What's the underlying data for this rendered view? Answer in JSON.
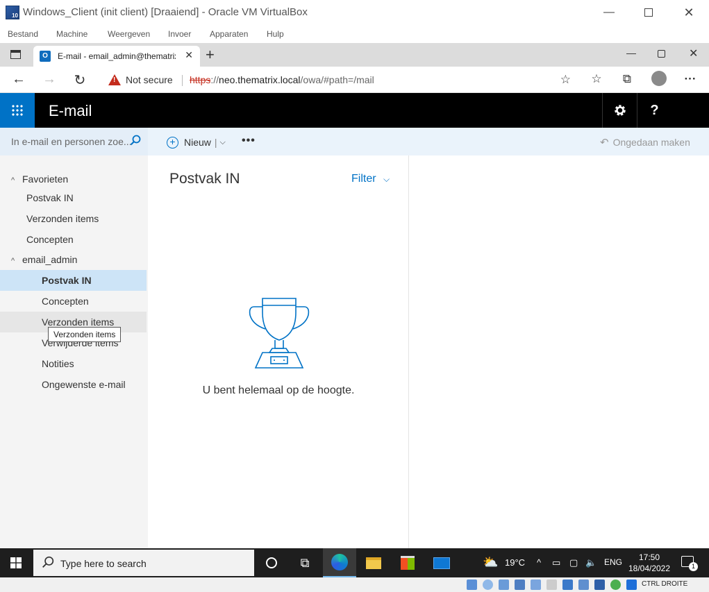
{
  "vbox": {
    "title": "Windows_Client (init client) [Draaiend] - Oracle VM VirtualBox",
    "menu": [
      "Bestand",
      "Machine",
      "Weergeven",
      "Invoer",
      "Apparaten",
      "Hulp"
    ],
    "host_key": "CTRL DROITE"
  },
  "browser": {
    "tab_title": "E-mail - email_admin@thematrix.local",
    "security_label": "Not secure",
    "url": {
      "scheme": "https",
      "sep": "://",
      "host": "neo.thematrix.local",
      "path": "/owa/#path=/mail"
    }
  },
  "owa": {
    "app_title": "E-mail",
    "settings_icon": "gear-icon",
    "help_label": "?",
    "search_placeholder": "In e-mail en personen zoe...",
    "new_label": "Nieuw",
    "undo_label": "Ongedaan maken",
    "favorites_label": "Favorieten",
    "favorites": [
      "Postvak IN",
      "Verzonden items",
      "Concepten"
    ],
    "account_label": "email_admin",
    "account_folders": [
      "Postvak IN",
      "Concepten",
      "Verzonden items",
      "Verwijderde items",
      "Notities",
      "Ongewenste e-mail"
    ],
    "tooltip": "Verzonden items",
    "list_title": "Postvak IN",
    "filter_label": "Filter",
    "empty_message": "U bent helemaal op de hoogte."
  },
  "taskbar": {
    "search_placeholder": "Type here to search",
    "weather_temp": "19°C",
    "language": "ENG",
    "time": "17:50",
    "date": "18/04/2022",
    "notification_count": "1"
  },
  "colors": {
    "owa_blue": "#0072c6",
    "selected_folder": "#cde4f7",
    "header_black": "#000000"
  }
}
